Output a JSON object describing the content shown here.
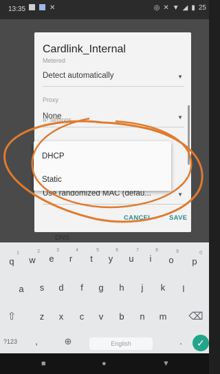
{
  "status_bar": {
    "time": "13:35",
    "battery": "25"
  },
  "dialog": {
    "title": "Cardlink_Internal",
    "metered_label": "Metered",
    "metered_value": "Detect automatically",
    "proxy_label": "Proxy",
    "proxy_value": "None",
    "ip_settings_label": "IP settings",
    "privacy_value": "Use randomized MAC (defau...",
    "cancel_label": "CANCEL",
    "save_label": "SAVE"
  },
  "ip_menu": {
    "options": [
      "DHCP",
      "Static"
    ]
  },
  "background": {
    "dns_label": "DNS"
  },
  "keyboard": {
    "row1": [
      "q",
      "w",
      "e",
      "r",
      "t",
      "y",
      "u",
      "i",
      "o",
      "p"
    ],
    "row1_hints": [
      "1",
      "2",
      "3",
      "4",
      "5",
      "6",
      "7",
      "8",
      "9",
      "0"
    ],
    "row2": [
      "a",
      "s",
      "d",
      "f",
      "g",
      "h",
      "j",
      "k",
      "l"
    ],
    "row3": [
      "z",
      "x",
      "c",
      "v",
      "b",
      "n",
      "m"
    ],
    "symbols_key": "?123",
    "comma_key": ",",
    "period_key": ".",
    "space_label": "English"
  },
  "colors": {
    "accent": "#2e8b8f",
    "annotation": "#e07a2e",
    "enter_key": "#22a58a"
  },
  "icons": [
    "shift-icon",
    "backspace-icon",
    "globe-icon",
    "enter-icon",
    "back-icon",
    "home-icon",
    "recents-icon"
  ]
}
